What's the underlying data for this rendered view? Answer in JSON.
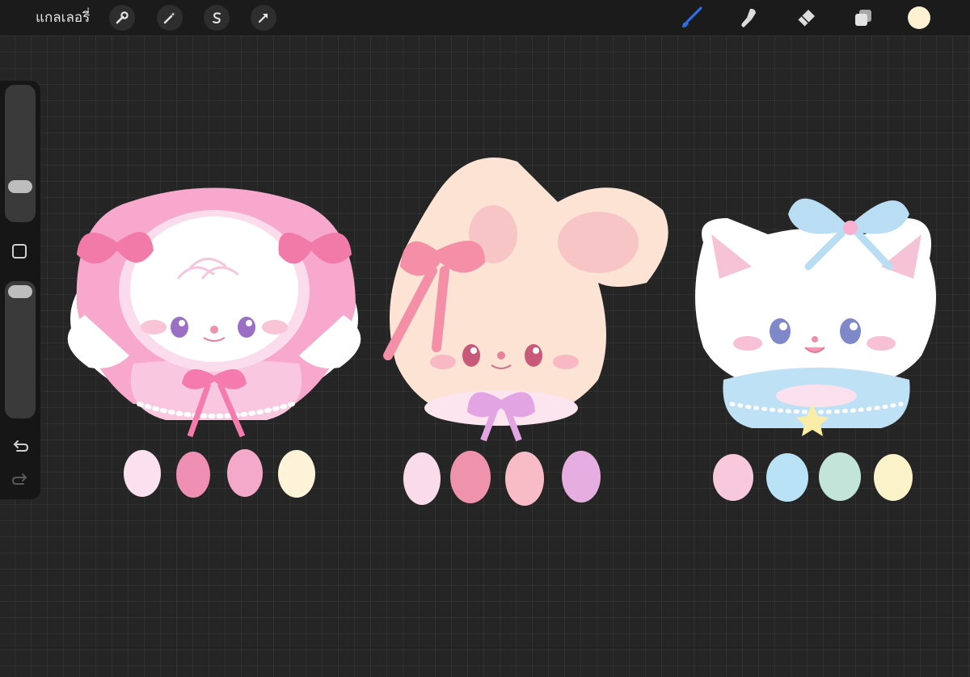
{
  "toolbar": {
    "gallery_label": "แกลเลอรี่",
    "left_tools": [
      "wrench-icon",
      "magic-wand-icon",
      "selection-icon",
      "transform-arrow-icon"
    ],
    "right_tools": [
      "brush-icon",
      "smudge-icon",
      "eraser-icon",
      "layers-icon"
    ],
    "active_tool": "brush",
    "current_color": "#fdf1d2"
  },
  "sidebar": {
    "brush_size_level": 0.68,
    "opacity_level": 0.05,
    "undo": "undo-icon",
    "redo": "redo-icon"
  },
  "palettes": [
    {
      "character": "sheep-in-bonnet",
      "colors": [
        "#fbe1f0",
        "#ef8fb4",
        "#f4a9cb",
        "#fdf3d8"
      ]
    },
    {
      "character": "bunny",
      "colors": [
        "#fadbea",
        "#ef93ad",
        "#f8bcc6",
        "#e6ade0"
      ]
    },
    {
      "character": "kitten",
      "colors": [
        "#f8c8dc",
        "#b9e2f7",
        "#c2e4d9",
        "#fcf2c9"
      ]
    }
  ]
}
